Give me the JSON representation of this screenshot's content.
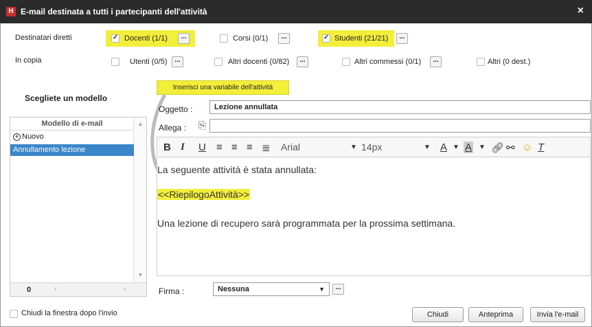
{
  "window": {
    "title": "E-mail destinata a tutti i partecipanti dell'attività",
    "logo": "H",
    "close": "×"
  },
  "recipients": {
    "direct_label": "Destinatari diretti",
    "cc_label": "In copia",
    "direct": [
      {
        "label": "Docenti (1/1)",
        "checked": true,
        "highlight": true
      },
      {
        "label": "Corsi (0/1)",
        "checked": false,
        "highlight": false
      },
      {
        "label": "Studenti (21/21)",
        "checked": true,
        "highlight": true
      }
    ],
    "cc": [
      {
        "label": "Utenti (0/5)",
        "checked": false
      },
      {
        "label": "Altri docenti (0/82)",
        "checked": false
      },
      {
        "label": "Altri commessi (0/1)",
        "checked": false
      },
      {
        "label": "Altri (0 dest.)",
        "checked": false
      }
    ],
    "more_label": "..."
  },
  "templates": {
    "title": "Scegliete un modello",
    "header": "Modello di e-mail",
    "items": [
      {
        "label": "Nuovo",
        "icon": "plus-circle-icon",
        "selected": false
      },
      {
        "label": "Annullamento lezione",
        "selected": true
      }
    ],
    "count": "0"
  },
  "variable_button": "Inserisci una variabile dell'attività",
  "form": {
    "subject_label": "Oggetto :",
    "subject_value": "Lezione annullata",
    "attach_label": "Allega :",
    "attach_value": ""
  },
  "editor_toolbar": {
    "bold": "B",
    "italic": "I",
    "underline": "U",
    "font": "Arial",
    "size": "14px",
    "text_color": "A",
    "bg_color": "A",
    "clear_format": "T"
  },
  "editor": {
    "line1": "La seguente attività è stata annullata:",
    "variable": "<<RiepilogoAttività>>",
    "line3": "Una lezione di recupero sarà programmata per la prossima settimana."
  },
  "signature": {
    "label": "Firma :",
    "value": "Nessuna"
  },
  "footer": {
    "close_after_send": "Chiudi la finestra dopo l'invio",
    "close_button": "Chiudi",
    "preview_button": "Anteprima",
    "send_button": "Invia l'e-mail"
  },
  "colors": {
    "highlight": "#f3ee3a",
    "selection": "#3a86c8",
    "titlebar": "#2b2b2b"
  }
}
